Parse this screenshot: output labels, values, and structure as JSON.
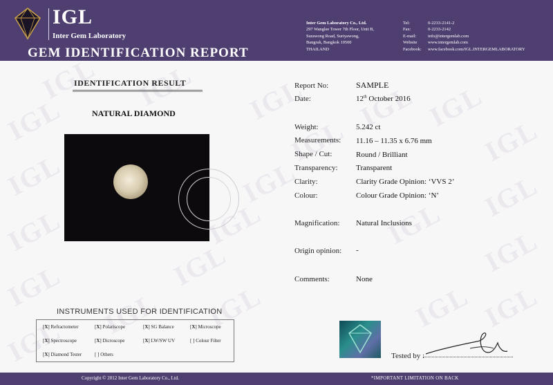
{
  "header": {
    "logo_text": "IGL",
    "logo_sub": "Inter Gem Laboratory",
    "report_title": "GEM IDENTIFICATION REPORT",
    "company": {
      "name": "Inter Gem Laboratory Co., Ltd.",
      "address_lines": [
        "297 Wanglee Tower 7th Floor, Unit B,",
        "Surawong Road, Suriyawong,",
        "Bangrak, Bangkok 10500",
        "THAILAND"
      ]
    },
    "contact": [
      {
        "key": "Tel:",
        "value": "0-2233-2141-2"
      },
      {
        "key": "Fax:",
        "value": "0-2233-2142"
      },
      {
        "key": "E-mail:",
        "value": "info@intergemlab.com"
      },
      {
        "key": "Website",
        "value": "www.intergemlab.com"
      },
      {
        "key": "Facebook:",
        "value": "www.facebook.com/IGL.INTERGEMLABORATORY"
      }
    ]
  },
  "watermark": "IGL",
  "left": {
    "section_title": "IDENTIFICATION RESULT",
    "stone_name": "NATURAL DIAMOND",
    "instruments_title": "INSTRUMENTS USED FOR IDENTIFICATION",
    "instruments": [
      {
        "mark": "X",
        "label": "Refractometer"
      },
      {
        "mark": "X",
        "label": "Polariscope"
      },
      {
        "mark": "X",
        "label": "SG Balance"
      },
      {
        "mark": "X",
        "label": "Microscope"
      },
      {
        "mark": "X",
        "label": "Spectroscope"
      },
      {
        "mark": "X",
        "label": "Dicroscope"
      },
      {
        "mark": "X",
        "label": "LW/SW UV"
      },
      {
        "mark": " ",
        "label": "Colour Filter"
      },
      {
        "mark": "X",
        "label": "Diamond Tester"
      },
      {
        "mark": " ",
        "label": "Others"
      }
    ]
  },
  "right": {
    "fields": [
      {
        "label": "Report No:",
        "value": "SAMPLE"
      },
      {
        "label": "Date:",
        "value_day": "12",
        "value_sup": "th",
        "value_rest": " October 2016"
      },
      {
        "label": "Weight:",
        "value": "5.242 ct"
      },
      {
        "label": "Measurements:",
        "value": "11.16 – 11.35 x 6.76 mm"
      },
      {
        "label": "Shape / Cut:",
        "value": "Round / Brilliant"
      },
      {
        "label": "Transparency:",
        "value": "Transparent"
      },
      {
        "label": "Clarity:",
        "value": "Clarity Grade Opinion: ‘VVS 2’"
      },
      {
        "label": "Colour:",
        "value": "Colour Grade Opinion: ‘N’"
      },
      {
        "label": "Magnification:",
        "value": "Natural Inclusions"
      },
      {
        "label": "Origin opinion:",
        "value": "-"
      },
      {
        "label": "Comments:",
        "value": "None"
      }
    ],
    "tested_by": "Tested by :"
  },
  "footer": {
    "copyright": "Copyright  ©  2012 Inter Gem Laboratory Co., Ltd.",
    "limitation": "*IMPORTANT LIMITATION ON BACK"
  },
  "colors": {
    "header_bg": "#4f3f70",
    "page_bg": "#f8f7f8"
  }
}
